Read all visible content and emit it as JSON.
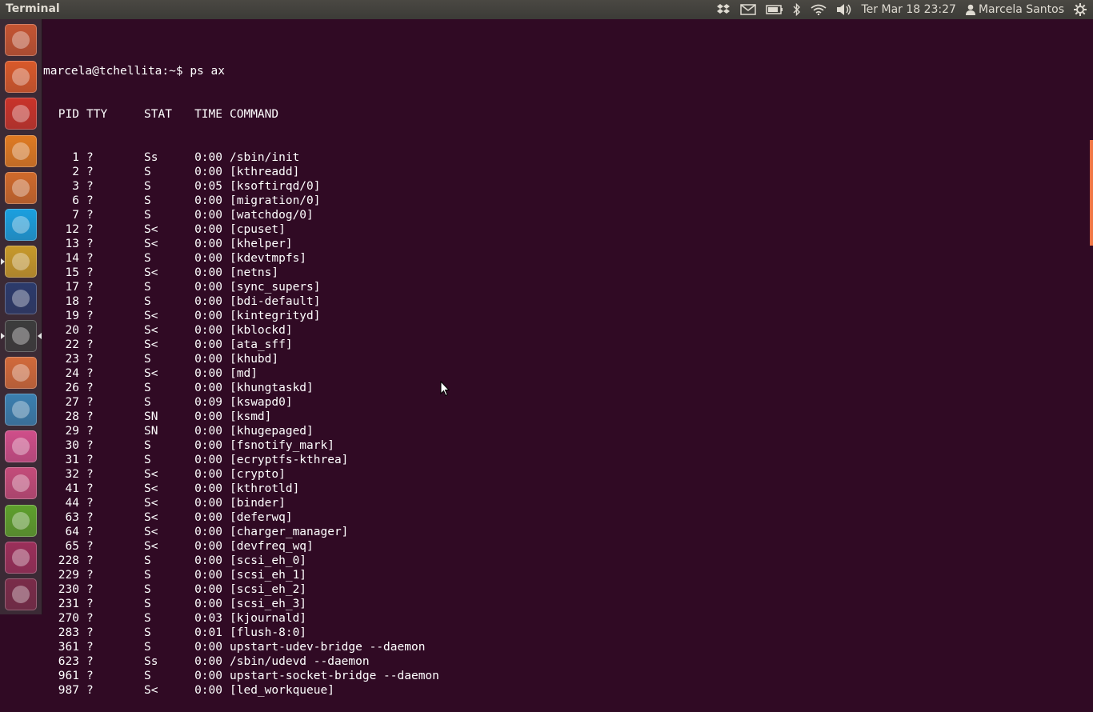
{
  "topbar": {
    "app_title": "Terminal",
    "clock": "Ter Mar 18 23:27",
    "user": "Marcela Santos",
    "indicators": [
      "dropbox-icon",
      "mail-icon",
      "battery-icon",
      "bluetooth-icon",
      "wifi-icon",
      "volume-icon",
      "user-icon",
      "gear-icon"
    ]
  },
  "launcher": {
    "items": [
      {
        "name": "dash-home",
        "color": "#c55432"
      },
      {
        "name": "software-center",
        "color": "#d9592a"
      },
      {
        "name": "system-settings",
        "color": "#c9332a"
      },
      {
        "name": "vlc",
        "color": "#e07b22"
      },
      {
        "name": "libreoffice-impress",
        "color": "#d06a2b"
      },
      {
        "name": "skype",
        "color": "#1aa0e0"
      },
      {
        "name": "chrome",
        "color": "#c89a2a"
      },
      {
        "name": "eclipse",
        "color": "#2b3a6b"
      },
      {
        "name": "terminal",
        "color": "#3c3c3c"
      },
      {
        "name": "home-folder",
        "color": "#d26a3a"
      },
      {
        "name": "system-monitor",
        "color": "#3a7fb0"
      },
      {
        "name": "picasa",
        "color": "#d04e8a"
      },
      {
        "name": "update-manager",
        "color": "#c44b7a"
      },
      {
        "name": "ubuntu-tweak",
        "color": "#5ea02c"
      },
      {
        "name": "workspace-switcher",
        "color": "#9b2f5a"
      },
      {
        "name": "trash",
        "color": "#7a2b49"
      }
    ]
  },
  "terminal": {
    "prompt": "marcela@tchellita:~$ ps ax",
    "headers": {
      "pid": "PID",
      "tty": "TTY",
      "stat": "STAT",
      "time": "TIME",
      "command": "COMMAND"
    },
    "rows": [
      [
        "1",
        "?",
        "Ss",
        "0:00",
        "/sbin/init"
      ],
      [
        "2",
        "?",
        "S",
        "0:00",
        "[kthreadd]"
      ],
      [
        "3",
        "?",
        "S",
        "0:05",
        "[ksoftirqd/0]"
      ],
      [
        "6",
        "?",
        "S",
        "0:00",
        "[migration/0]"
      ],
      [
        "7",
        "?",
        "S",
        "0:00",
        "[watchdog/0]"
      ],
      [
        "12",
        "?",
        "S<",
        "0:00",
        "[cpuset]"
      ],
      [
        "13",
        "?",
        "S<",
        "0:00",
        "[khelper]"
      ],
      [
        "14",
        "?",
        "S",
        "0:00",
        "[kdevtmpfs]"
      ],
      [
        "15",
        "?",
        "S<",
        "0:00",
        "[netns]"
      ],
      [
        "17",
        "?",
        "S",
        "0:00",
        "[sync_supers]"
      ],
      [
        "18",
        "?",
        "S",
        "0:00",
        "[bdi-default]"
      ],
      [
        "19",
        "?",
        "S<",
        "0:00",
        "[kintegrityd]"
      ],
      [
        "20",
        "?",
        "S<",
        "0:00",
        "[kblockd]"
      ],
      [
        "22",
        "?",
        "S<",
        "0:00",
        "[ata_sff]"
      ],
      [
        "23",
        "?",
        "S",
        "0:00",
        "[khubd]"
      ],
      [
        "24",
        "?",
        "S<",
        "0:00",
        "[md]"
      ],
      [
        "26",
        "?",
        "S",
        "0:00",
        "[khungtaskd]"
      ],
      [
        "27",
        "?",
        "S",
        "0:09",
        "[kswapd0]"
      ],
      [
        "28",
        "?",
        "SN",
        "0:00",
        "[ksmd]"
      ],
      [
        "29",
        "?",
        "SN",
        "0:00",
        "[khugepaged]"
      ],
      [
        "30",
        "?",
        "S",
        "0:00",
        "[fsnotify_mark]"
      ],
      [
        "31",
        "?",
        "S",
        "0:00",
        "[ecryptfs-kthrea]"
      ],
      [
        "32",
        "?",
        "S<",
        "0:00",
        "[crypto]"
      ],
      [
        "41",
        "?",
        "S<",
        "0:00",
        "[kthrotld]"
      ],
      [
        "44",
        "?",
        "S<",
        "0:00",
        "[binder]"
      ],
      [
        "63",
        "?",
        "S<",
        "0:00",
        "[deferwq]"
      ],
      [
        "64",
        "?",
        "S<",
        "0:00",
        "[charger_manager]"
      ],
      [
        "65",
        "?",
        "S<",
        "0:00",
        "[devfreq_wq]"
      ],
      [
        "228",
        "?",
        "S",
        "0:00",
        "[scsi_eh_0]"
      ],
      [
        "229",
        "?",
        "S",
        "0:00",
        "[scsi_eh_1]"
      ],
      [
        "230",
        "?",
        "S",
        "0:00",
        "[scsi_eh_2]"
      ],
      [
        "231",
        "?",
        "S",
        "0:00",
        "[scsi_eh_3]"
      ],
      [
        "270",
        "?",
        "S",
        "0:03",
        "[kjournald]"
      ],
      [
        "283",
        "?",
        "S",
        "0:01",
        "[flush-8:0]"
      ],
      [
        "361",
        "?",
        "S",
        "0:00",
        "upstart-udev-bridge --daemon"
      ],
      [
        "623",
        "?",
        "Ss",
        "0:00",
        "/sbin/udevd --daemon"
      ],
      [
        "961",
        "?",
        "S",
        "0:00",
        "upstart-socket-bridge --daemon"
      ],
      [
        "987",
        "?",
        "S<",
        "0:00",
        "[led_workqueue]"
      ]
    ]
  },
  "colors": {
    "background": "#300a24",
    "topbar": "#3c3b37",
    "accent": "#f07746",
    "text": "#ffffff"
  }
}
